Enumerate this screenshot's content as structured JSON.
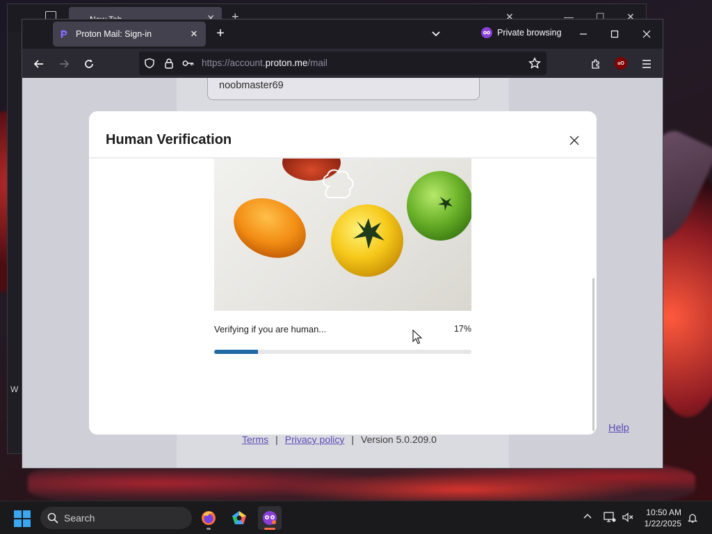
{
  "background_window": {
    "tab_title": "New Tab"
  },
  "browser": {
    "tab": {
      "title": "Proton Mail: Sign-in"
    },
    "private_label": "Private browsing",
    "url": {
      "scheme": "https://account.",
      "host": "proton.me",
      "path": "/mail"
    }
  },
  "page": {
    "username_value": "noobmaster69",
    "footer": {
      "terms": "Terms",
      "privacy": "Privacy policy",
      "version": "Version 5.0.209.0"
    },
    "help": "Help"
  },
  "modal": {
    "title": "Human Verification",
    "status_text": "Verifying if you are human...",
    "progress_label": "17%",
    "progress_value": 0.17
  },
  "taskbar": {
    "search_placeholder": "Search",
    "time": "10:50 AM",
    "date": "1/22/2025"
  },
  "colors": {
    "progress_fill": "#1f6aa6",
    "link": "#5a4bb5",
    "private_purple": "#8a3fd6"
  }
}
